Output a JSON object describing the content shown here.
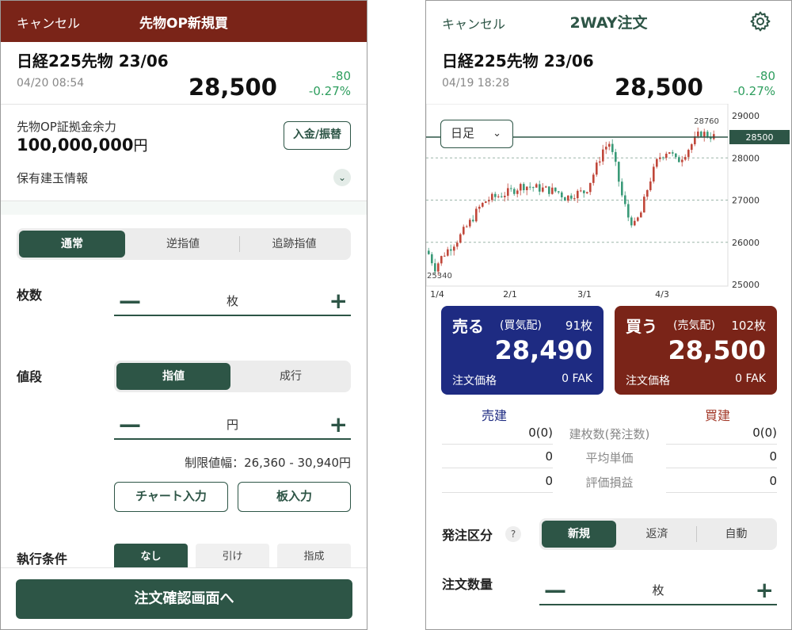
{
  "left": {
    "header": {
      "cancel": "キャンセル",
      "title": "先物OP新規買"
    },
    "instrument": {
      "name": "日経225先物 23/06",
      "time": "04/20 08:54",
      "price": "28,500",
      "change": "-80",
      "change_pct": "-0.27%"
    },
    "margin": {
      "label": "先物OP証拠金余力",
      "amount": "100,000,000",
      "unit": "円",
      "deposit_button": "入金/振替"
    },
    "holdings": {
      "label": "保有建玉情報"
    },
    "order_type_tabs": [
      "通常",
      "逆指値",
      "追跡指値"
    ],
    "quantity": {
      "label": "枚数",
      "unit": "枚"
    },
    "price": {
      "label": "値段",
      "tabs": [
        "指値",
        "成行"
      ],
      "unit": "円",
      "limit_range": "制限値幅：26,360 - 30,940円",
      "chart_input": "チャート入力",
      "board_input": "板入力"
    },
    "condition": {
      "label": "執行条件",
      "options": [
        "なし",
        "引け",
        "指成"
      ]
    },
    "confirm_button": "注文確認画面へ"
  },
  "right": {
    "header": {
      "cancel": "キャンセル",
      "title": "2WAY注文"
    },
    "icons": {
      "settings": "gear-icon"
    },
    "instrument": {
      "name": "日経225先物 23/06",
      "time": "04/19 18:28",
      "price": "28,500",
      "change": "-80",
      "change_pct": "-0.27%"
    },
    "timeframe": "日足",
    "chart_data": {
      "type": "candlestick",
      "y_ticks": [
        "29000",
        "28000",
        "27000",
        "26000",
        "25000"
      ],
      "x_ticks": [
        "1/4",
        "2/1",
        "3/1",
        "4/3"
      ],
      "current_price_label": "28500",
      "high_label": "28760",
      "low_label": "25340",
      "ylim": [
        25000,
        29000
      ]
    },
    "sell": {
      "action": "売る",
      "sub": "(買気配)",
      "qty": "91枚",
      "price": "28,490",
      "price_label": "注文価格",
      "type": "0 FAK"
    },
    "buy": {
      "action": "買う",
      "sub": "(売気配)",
      "qty": "102枚",
      "price": "28,500",
      "price_label": "注文価格",
      "type": "0 FAK"
    },
    "positions": {
      "sell_header": "売建",
      "buy_header": "買建",
      "rows": [
        {
          "label": "建枚数(発注数)",
          "sell": "0(0)",
          "buy": "0(0)"
        },
        {
          "label": "平均単価",
          "sell": "0",
          "buy": "0"
        },
        {
          "label": "評価損益",
          "sell": "0",
          "buy": "0"
        }
      ]
    },
    "order_kind": {
      "label": "発注区分",
      "help": "?",
      "options": [
        "新規",
        "返済",
        "自動"
      ]
    },
    "quantity": {
      "label": "注文数量",
      "unit": "枚"
    }
  }
}
